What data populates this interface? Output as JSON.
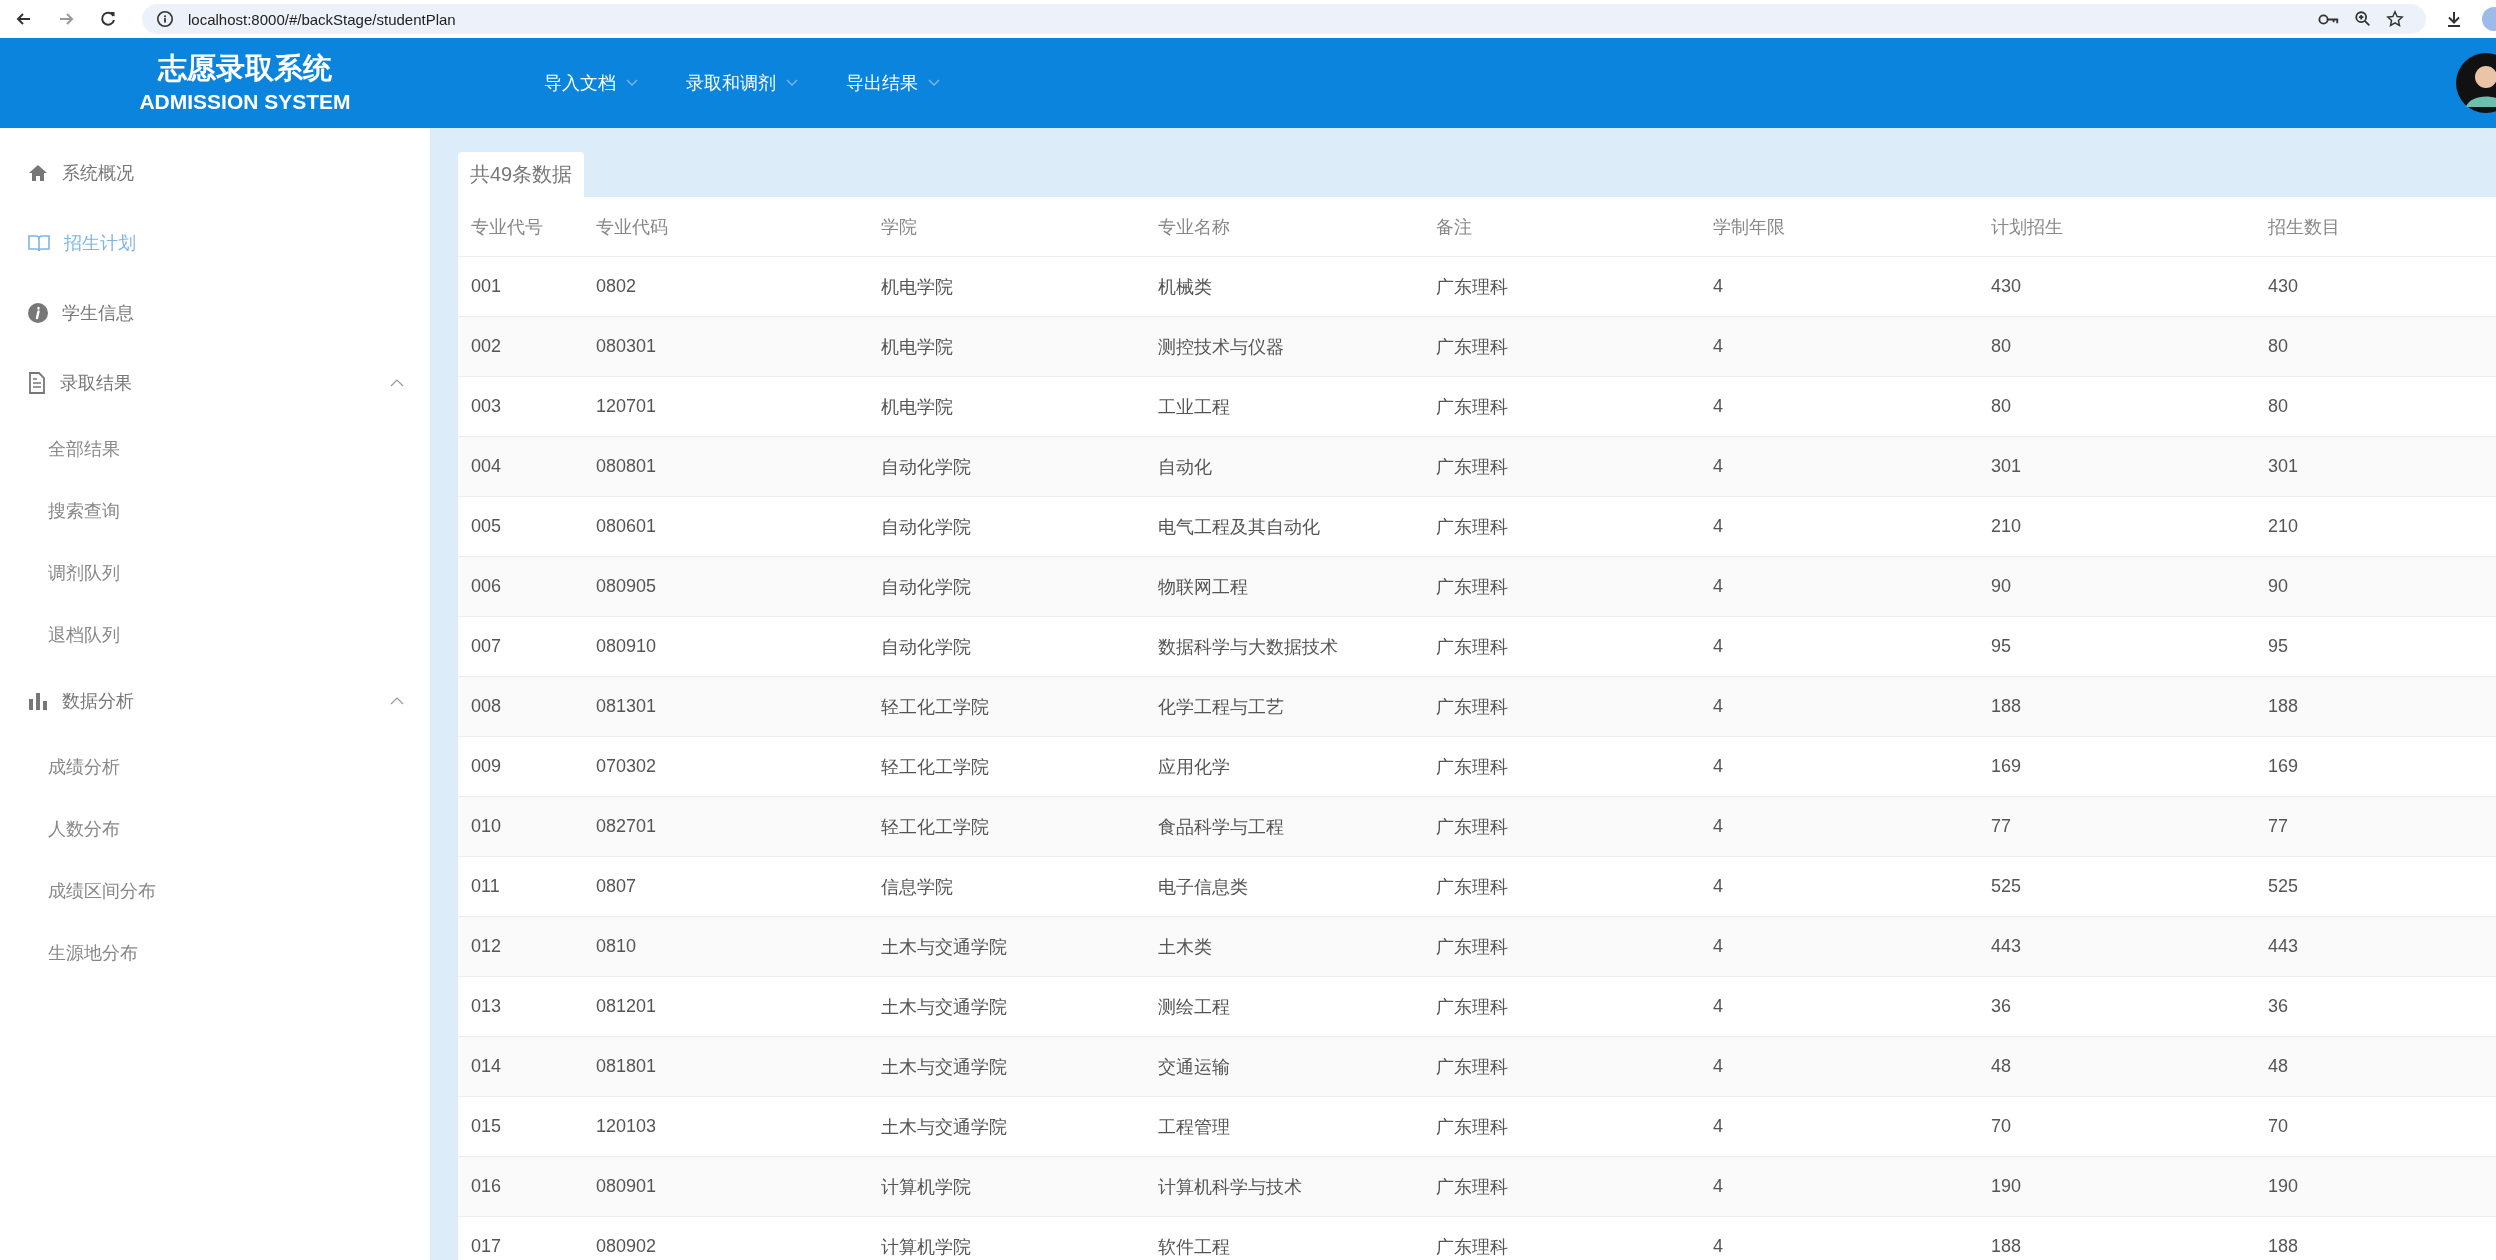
{
  "browser": {
    "url": "localhost:8000/#/backStage/studentPlan"
  },
  "header": {
    "title": "志愿录取系统",
    "subtitle": "ADMISSION SYSTEM",
    "nav": [
      {
        "label": "导入文档"
      },
      {
        "label": "录取和调剂"
      },
      {
        "label": "导出结果"
      }
    ]
  },
  "sidebar": {
    "items": [
      {
        "kind": "item",
        "label": "系统概况",
        "selected": false
      },
      {
        "kind": "item",
        "label": "招生计划",
        "selected": true
      },
      {
        "kind": "item",
        "label": "学生信息",
        "selected": false
      },
      {
        "kind": "group",
        "label": "录取结果",
        "expanded": true,
        "children": [
          {
            "label": "全部结果",
            "selected": false
          },
          {
            "label": "搜索查询",
            "selected": false
          },
          {
            "label": "调剂队列",
            "selected": false
          },
          {
            "label": "退档队列",
            "selected": false
          }
        ]
      },
      {
        "kind": "group",
        "label": "数据分析",
        "expanded": true,
        "children": [
          {
            "label": "成绩分析",
            "selected": false
          },
          {
            "label": "人数分布",
            "selected": false
          },
          {
            "label": "成绩区间分布",
            "selected": false
          },
          {
            "label": "生源地分布",
            "selected": false
          }
        ]
      }
    ]
  },
  "table": {
    "count_tab": "共49条数据",
    "columns": [
      "专业代号",
      "专业代码",
      "学院",
      "专业名称",
      "备注",
      "学制年限",
      "计划招生",
      "招生数目"
    ],
    "rows": [
      [
        "001",
        "0802",
        "机电学院",
        "机械类",
        "广东理科",
        "4",
        "430",
        "430"
      ],
      [
        "002",
        "080301",
        "机电学院",
        "测控技术与仪器",
        "广东理科",
        "4",
        "80",
        "80"
      ],
      [
        "003",
        "120701",
        "机电学院",
        "工业工程",
        "广东理科",
        "4",
        "80",
        "80"
      ],
      [
        "004",
        "080801",
        "自动化学院",
        "自动化",
        "广东理科",
        "4",
        "301",
        "301"
      ],
      [
        "005",
        "080601",
        "自动化学院",
        "电气工程及其自动化",
        "广东理科",
        "4",
        "210",
        "210"
      ],
      [
        "006",
        "080905",
        "自动化学院",
        "物联网工程",
        "广东理科",
        "4",
        "90",
        "90"
      ],
      [
        "007",
        "080910",
        "自动化学院",
        "数据科学与大数据技术",
        "广东理科",
        "4",
        "95",
        "95"
      ],
      [
        "008",
        "081301",
        "轻工化工学院",
        "化学工程与工艺",
        "广东理科",
        "4",
        "188",
        "188"
      ],
      [
        "009",
        "070302",
        "轻工化工学院",
        "应用化学",
        "广东理科",
        "4",
        "169",
        "169"
      ],
      [
        "010",
        "082701",
        "轻工化工学院",
        "食品科学与工程",
        "广东理科",
        "4",
        "77",
        "77"
      ],
      [
        "011",
        "0807",
        "信息学院",
        "电子信息类",
        "广东理科",
        "4",
        "525",
        "525"
      ],
      [
        "012",
        "0810",
        "土木与交通学院",
        "土木类",
        "广东理科",
        "4",
        "443",
        "443"
      ],
      [
        "013",
        "081201",
        "土木与交通学院",
        "测绘工程",
        "广东理科",
        "4",
        "36",
        "36"
      ],
      [
        "014",
        "081801",
        "土木与交通学院",
        "交通运输",
        "广东理科",
        "4",
        "48",
        "48"
      ],
      [
        "015",
        "120103",
        "土木与交通学院",
        "工程管理",
        "广东理科",
        "4",
        "70",
        "70"
      ],
      [
        "016",
        "080901",
        "计算机学院",
        "计算机科学与技术",
        "广东理科",
        "4",
        "190",
        "190"
      ],
      [
        "017",
        "080902",
        "计算机学院",
        "软件工程",
        "广东理科",
        "4",
        "188",
        "188"
      ]
    ]
  }
}
